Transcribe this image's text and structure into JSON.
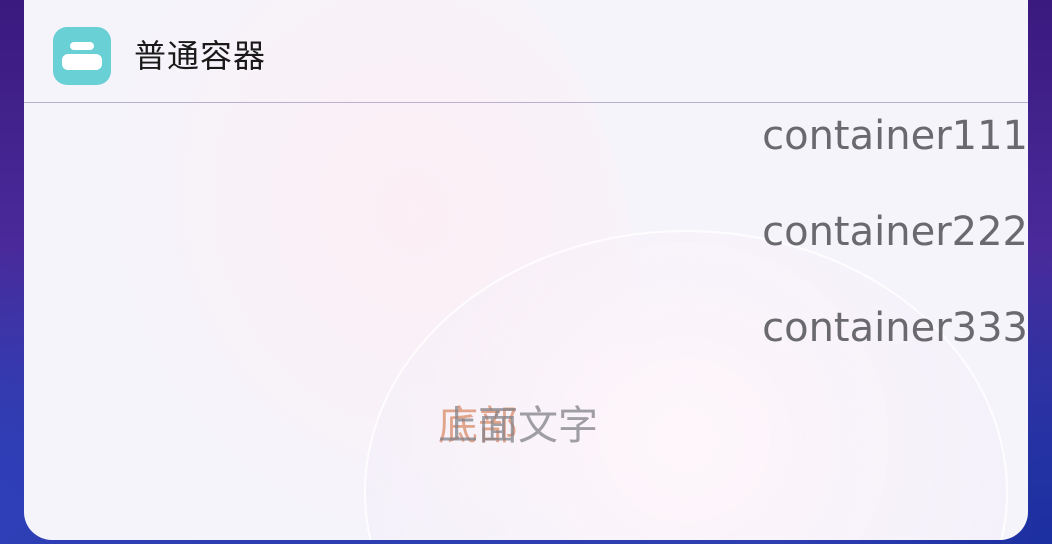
{
  "app": {
    "title": "普通容器",
    "icon": "container-app-icon"
  },
  "rows": [
    {
      "text": "container111"
    },
    {
      "text": "container222"
    },
    {
      "text": "container333"
    }
  ],
  "stack": {
    "bottom_text": "底部",
    "top_text": "上面文字"
  },
  "colors": {
    "app_icon": "#69d0d6",
    "row_text": "#6a6a6e",
    "stack_bottom_text": "#e1a58c",
    "stack_top_text": "#828288",
    "card_background": "#f6f4fb"
  }
}
